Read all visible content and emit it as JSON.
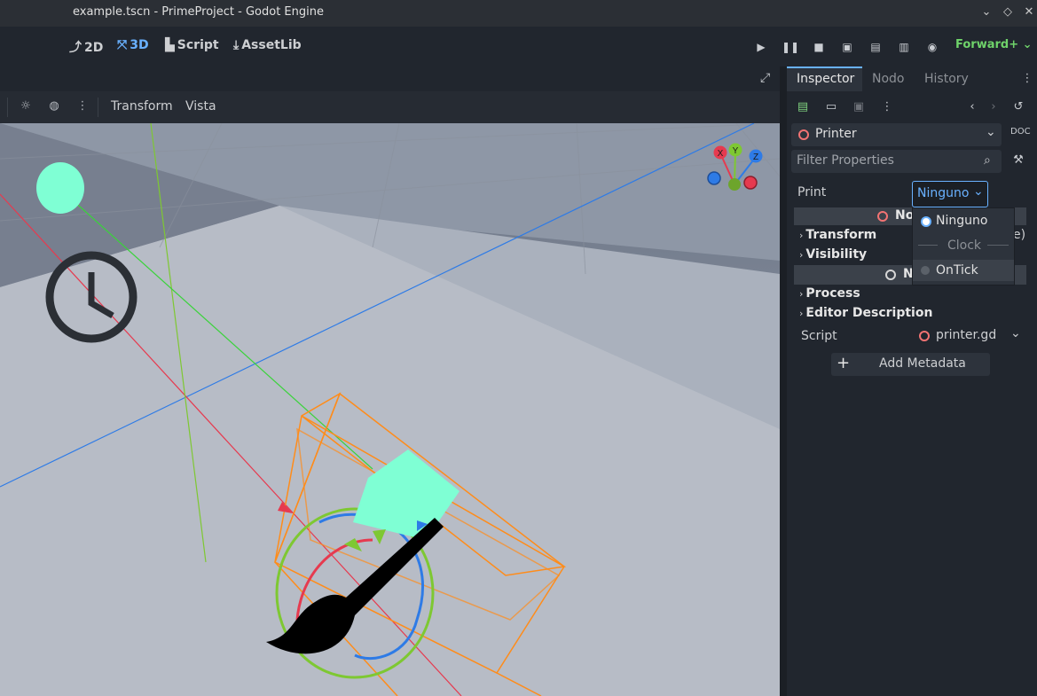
{
  "window": {
    "title": "example.tscn - PrimeProject - Godot Engine"
  },
  "main_tabs": [
    {
      "label": "2D",
      "icon": "2d-icon"
    },
    {
      "label": "3D",
      "icon": "3d-icon",
      "active": true
    },
    {
      "label": "Script",
      "icon": "script-icon"
    },
    {
      "label": "AssetLib",
      "icon": "assetlib-icon"
    }
  ],
  "renderer": {
    "label": "Forward+"
  },
  "viewport_toolbar": {
    "transform_label": "Transform",
    "view_label": "Vista"
  },
  "gizmo": {
    "x": "X",
    "y": "Y",
    "z": "Z"
  },
  "dock": {
    "tabs": [
      "Inspector",
      "Nodo",
      "History"
    ],
    "node_name": "Printer",
    "filter_placeholder": "Filter Properties",
    "print_label": "Print",
    "print_value": "Ninguno",
    "section_script_class": "No",
    "section_node_class": "N",
    "sections": [
      "Transform",
      "Visibility",
      "Process",
      "Editor Description"
    ],
    "hidden_suffix": "e)",
    "script_label": "Script",
    "script_value": "printer.gd",
    "add_metadata": "Add Metadata"
  },
  "dropdown": {
    "options": [
      "Ninguno",
      "OnTick"
    ],
    "separator": "Clock",
    "selected": "Ninguno"
  },
  "colors": {
    "accent": "#69b1ff",
    "renderer": "#6fd36a",
    "script_ring": "#f27373",
    "selection": "#ff8c1a",
    "mesh": "#7fffd4"
  }
}
